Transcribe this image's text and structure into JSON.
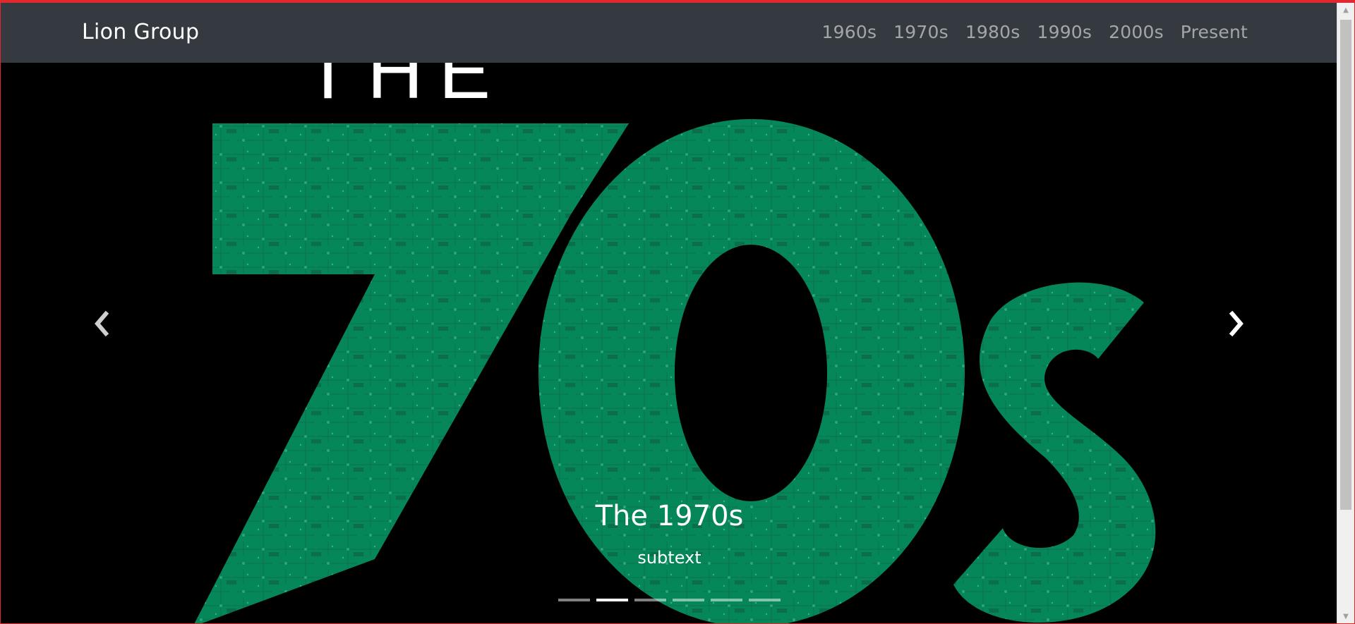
{
  "navbar": {
    "brand": "Lion Group",
    "links": [
      "1960s",
      "1970s",
      "1980s",
      "1990s",
      "2000s",
      "Present"
    ]
  },
  "hero": {
    "the_text": "THE",
    "decade_text": "70s",
    "accent_color": "#05875a"
  },
  "carousel": {
    "caption_title": "The 1970s",
    "caption_subtext": "subtext",
    "indicator_count": 6,
    "active_index": 1
  }
}
